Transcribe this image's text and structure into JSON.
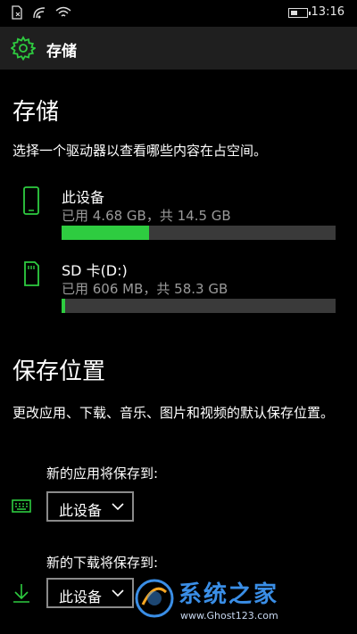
{
  "statusbar": {
    "time": "13:16"
  },
  "header": {
    "title": "存储",
    "icon": "gear-icon"
  },
  "storage": {
    "title": "存储",
    "description": "选择一个驱动器以查看哪些内容在占空间。",
    "drives": [
      {
        "name": "此设备",
        "usage": "已用 4.68 GB，共 14.5 GB",
        "icon": "phone-icon",
        "used_fraction": 0.32
      },
      {
        "name": "SD 卡(D:)",
        "usage": "已用 606 MB，共 58.3 GB",
        "icon": "sd-card-icon",
        "used_fraction": 0.01
      }
    ]
  },
  "save_locations": {
    "title": "保存位置",
    "description": "更改应用、下载、音乐、图片和视频的默认保存位置。",
    "apps": {
      "label": "新的应用将保存到:",
      "value": "此设备",
      "icon": "apps-icon"
    },
    "downloads": {
      "label": "新的下载将保存到:",
      "value": "此设备",
      "icon": "download-icon"
    }
  },
  "watermark": {
    "text": "系统之家",
    "url": "www.Ghost123.com"
  },
  "colors": {
    "accent": "#2ecc40",
    "background": "#000000",
    "header": "#1f1f1f",
    "muted": "#9a9a9a"
  }
}
